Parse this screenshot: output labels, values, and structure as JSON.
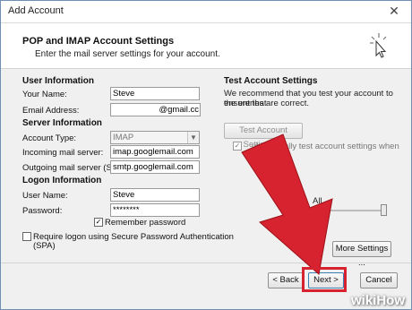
{
  "window": {
    "title": "Add Account",
    "close_glyph": "✕"
  },
  "header": {
    "title": "POP and IMAP Account Settings",
    "subtitle": "Enter the mail server settings for your account."
  },
  "user_information": {
    "heading": "User Information",
    "name_label": "Your Name:",
    "name_value": "Steve",
    "email_label": "Email Address:",
    "email_value": "@gmail.cc"
  },
  "server_information": {
    "heading": "Server Information",
    "account_type_label": "Account Type:",
    "account_type_value": "IMAP",
    "incoming_label": "Incoming mail server:",
    "incoming_value": "imap.googlemail.com",
    "outgoing_label": "Outgoing mail server (SMTP):",
    "outgoing_value": "smtp.googlemail.com"
  },
  "logon_information": {
    "heading": "Logon Information",
    "user_label": "User Name:",
    "user_value": "Steve",
    "password_label": "Password:",
    "password_value": "********",
    "remember_label": "Remember password",
    "remember_checked": true,
    "spa_label_1": "Require logon using Secure Password Authentication",
    "spa_label_2": "(SPA)",
    "spa_checked": false
  },
  "test_account": {
    "heading": "Test Account Settings",
    "desc_1": "We recommend that you test your account to ensure that",
    "desc_2": "the entries are correct.",
    "test_button": "Test Account Settings ...",
    "auto_test_label_1": "utomatically test account settings when Next",
    "auto_test_label_2": "ed",
    "auto_test_checked": true,
    "mail_to_keep_partial": "e:",
    "mail_to_keep_value": "All",
    "slider_fraction": 1.0
  },
  "buttons": {
    "more_settings": "More Settings ...",
    "back": "< Back",
    "next": "Next >",
    "cancel": "Cancel"
  },
  "overlay": {
    "arrow_color": "#d6232f",
    "highlight_color": "#d6232f"
  },
  "watermark": "wikiHow"
}
